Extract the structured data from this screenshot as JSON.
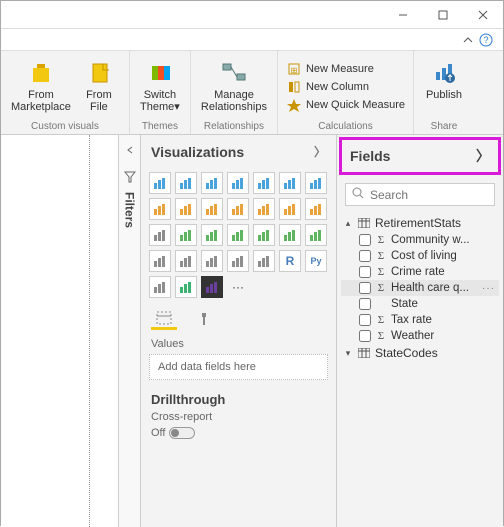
{
  "window": {
    "min": "—",
    "max": "▢",
    "close": "✕"
  },
  "ribbon": {
    "customVisuals": {
      "label": "Custom visuals",
      "fromMarketplace": "From\nMarketplace",
      "fromFile": "From\nFile"
    },
    "themes": {
      "label": "Themes",
      "switchTheme": "Switch\nTheme▾"
    },
    "relationships": {
      "label": "Relationships",
      "manage": "Manage\nRelationships"
    },
    "calculations": {
      "label": "Calculations",
      "newMeasure": "New Measure",
      "newColumn": "New Column",
      "newQuick": "New Quick Measure"
    },
    "share": {
      "label": "Share",
      "publish": "Publish"
    }
  },
  "filters": {
    "label": "Filters"
  },
  "viz": {
    "title": "Visualizations",
    "values": "Values",
    "dropHint": "Add data fields here",
    "drill": "Drillthrough",
    "cross": "Cross-report",
    "toggle": "Off"
  },
  "fields": {
    "title": "Fields",
    "searchPlaceholder": "Search",
    "tables": [
      {
        "name": "RetirementStats",
        "expanded": true,
        "fields": [
          {
            "name": "Community w...",
            "sigma": true
          },
          {
            "name": "Cost of living",
            "sigma": true
          },
          {
            "name": "Crime rate",
            "sigma": true
          },
          {
            "name": "Health care q...",
            "sigma": true,
            "hover": true
          },
          {
            "name": "State",
            "sigma": false
          },
          {
            "name": "Tax rate",
            "sigma": true
          },
          {
            "name": "Weather",
            "sigma": true
          }
        ]
      },
      {
        "name": "StateCodes",
        "expanded": false
      }
    ]
  }
}
